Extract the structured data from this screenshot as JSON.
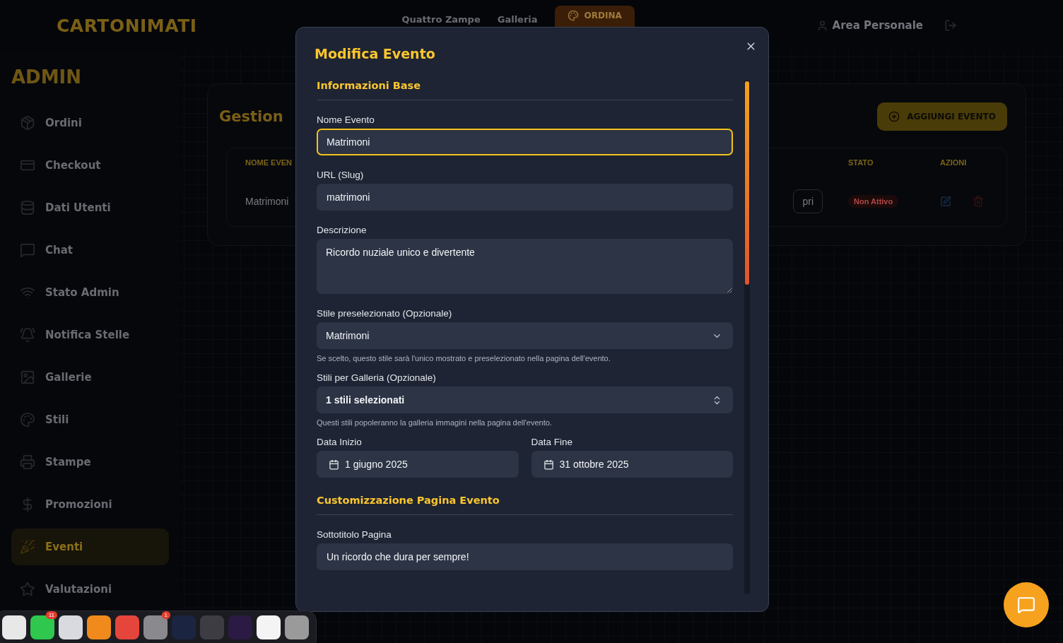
{
  "header": {
    "logo": "CARTONIMATI",
    "nav": [
      "Quattro Zampe",
      "Galleria"
    ],
    "order_button": "ORDINA",
    "account": "Area Personale"
  },
  "sidebar": {
    "title": "ADMIN",
    "items": [
      {
        "label": "Ordini",
        "selected": false
      },
      {
        "label": "Checkout",
        "selected": false
      },
      {
        "label": "Dati Utenti",
        "selected": false
      },
      {
        "label": "Chat",
        "selected": false
      },
      {
        "label": "Stato Admin",
        "selected": false
      },
      {
        "label": "Notifica Stelle",
        "selected": false
      },
      {
        "label": "Gallerie",
        "selected": false
      },
      {
        "label": "Stili",
        "selected": false
      },
      {
        "label": "Stampe",
        "selected": false
      },
      {
        "label": "Promozioni",
        "selected": false
      },
      {
        "label": "Eventi",
        "selected": true
      },
      {
        "label": "Valutazioni",
        "selected": false
      }
    ]
  },
  "main": {
    "title": "Gestion",
    "add_button": "AGGIUNGI EVENTO",
    "columns": [
      "NOME EVEN",
      "STATO",
      "AZIONI"
    ],
    "rows": [
      {
        "name": "Matrimoni",
        "link": "pri",
        "status": "Non Attivo"
      }
    ]
  },
  "modal": {
    "title": "Modifica Evento",
    "sections": [
      {
        "title": "Informazioni Base",
        "fields": [
          {
            "kind": "input",
            "label": "Nome Evento",
            "value": "Matrimoni",
            "focused": true
          },
          {
            "kind": "input",
            "label": "URL (Slug)",
            "value": "matrimoni",
            "focused": false
          },
          {
            "kind": "textarea",
            "label": "Descrizione",
            "value": "Ricordo nuziale unico e divertente"
          },
          {
            "kind": "select",
            "label": "Stile preselezionato (Opzionale)",
            "value": "Matrimoni",
            "hint": "Se scelto, questo stile sarà l'unico mostrato e preselezionato nella pagina dell'evento."
          },
          {
            "kind": "multiselect",
            "label": "Stili per Galleria (Opzionale)",
            "value": "1 stili selezionati",
            "hint": "Questi stili popoleranno la galleria immagini nella pagina dell'evento."
          },
          {
            "kind": "dates",
            "items": [
              {
                "label": "Data Inizio",
                "value": "1 giugno 2025"
              },
              {
                "label": "Data Fine",
                "value": "31 ottobre 2025"
              }
            ]
          }
        ]
      },
      {
        "title": "Customizzazione Pagina Evento",
        "fields": [
          {
            "kind": "input",
            "label": "Sottotitolo Pagina",
            "value": "Un ricordo che dura per sempre!",
            "focused": false
          }
        ]
      }
    ]
  },
  "dock": [
    {
      "color": "#e8e8e8"
    },
    {
      "color": "#2fc74e",
      "badge": "11"
    },
    {
      "color": "#d9d9e0"
    },
    {
      "color": "#f08a1c"
    },
    {
      "color": "#e5453a"
    },
    {
      "color": "#8a8a8e",
      "badge": "1"
    },
    {
      "color": "#1b2440"
    },
    {
      "color": "#3c3c42"
    },
    {
      "color": "#2a1a44"
    },
    {
      "color": "#f4f4f4"
    },
    {
      "color": "#9a9a9a"
    }
  ]
}
